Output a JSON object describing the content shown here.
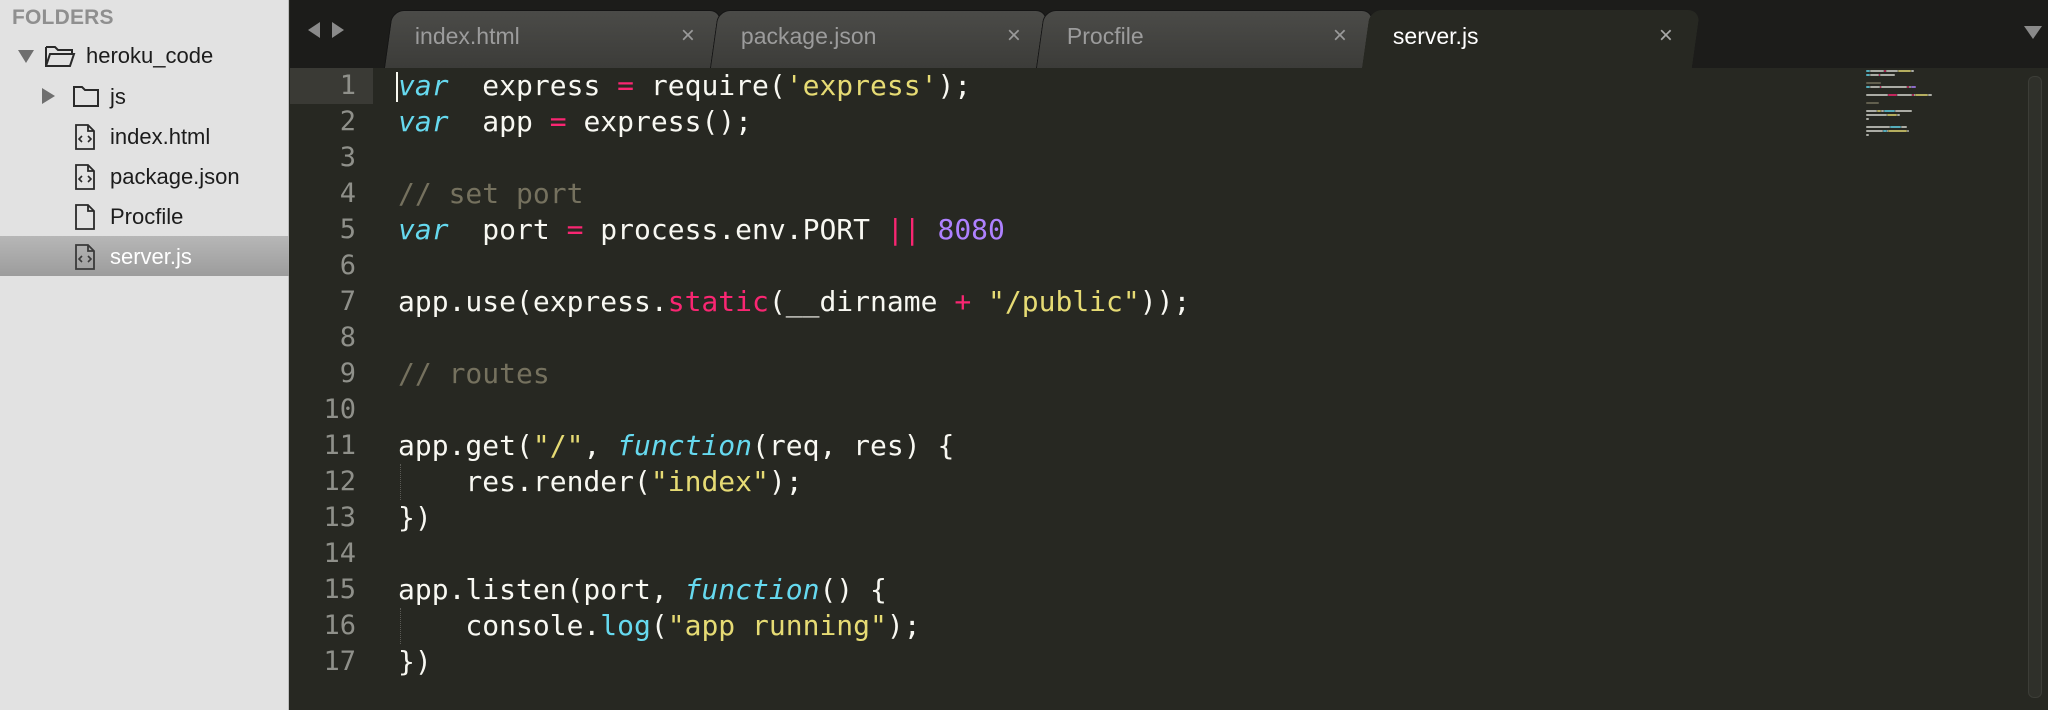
{
  "sidebar": {
    "header": "FOLDERS",
    "items": [
      {
        "label": "heroku_code",
        "icon": "folder-open-icon",
        "expanded": true
      },
      {
        "label": "js",
        "icon": "folder-icon",
        "expanded": false
      },
      {
        "label": "index.html",
        "icon": "code-file-icon"
      },
      {
        "label": "package.json",
        "icon": "code-file-icon"
      },
      {
        "label": "Procfile",
        "icon": "file-icon"
      },
      {
        "label": "server.js",
        "icon": "code-file-icon",
        "selected": true
      }
    ]
  },
  "tabs": [
    {
      "label": "index.html",
      "close": "×"
    },
    {
      "label": "package.json",
      "close": "×"
    },
    {
      "label": "Procfile",
      "close": "×"
    },
    {
      "label": "server.js",
      "close": "×",
      "active": true
    }
  ],
  "editor": {
    "current_line": 1,
    "lines": [
      {
        "n": "1",
        "tokens": [
          [
            "kw",
            "var"
          ],
          [
            "",
            "  express "
          ],
          [
            "op",
            "="
          ],
          [
            "",
            " require("
          ],
          [
            "str",
            "'express'"
          ],
          [
            "",
            ");"
          ]
        ]
      },
      {
        "n": "2",
        "tokens": [
          [
            "kw",
            "var"
          ],
          [
            "",
            "  app "
          ],
          [
            "op",
            "="
          ],
          [
            "",
            " express();"
          ]
        ]
      },
      {
        "n": "3",
        "tokens": []
      },
      {
        "n": "4",
        "tokens": [
          [
            "cm",
            "// set port"
          ]
        ]
      },
      {
        "n": "5",
        "tokens": [
          [
            "kw",
            "var"
          ],
          [
            "",
            "  port "
          ],
          [
            "op",
            "="
          ],
          [
            "",
            " process.env.PORT "
          ],
          [
            "op",
            "||"
          ],
          [
            "",
            " "
          ],
          [
            "num",
            "8080"
          ]
        ]
      },
      {
        "n": "6",
        "tokens": []
      },
      {
        "n": "7",
        "tokens": [
          [
            "",
            "app.use(express."
          ],
          [
            "sp",
            "static"
          ],
          [
            "",
            "(__dirname "
          ],
          [
            "op",
            "+"
          ],
          [
            "",
            " "
          ],
          [
            "str",
            "\"/public\""
          ],
          [
            "",
            "));"
          ]
        ]
      },
      {
        "n": "8",
        "tokens": []
      },
      {
        "n": "9",
        "tokens": [
          [
            "cm",
            "// routes"
          ]
        ]
      },
      {
        "n": "10",
        "tokens": []
      },
      {
        "n": "11",
        "tokens": [
          [
            "",
            "app.get("
          ],
          [
            "str",
            "\"/\""
          ],
          [
            "",
            ", "
          ],
          [
            "fn",
            "function"
          ],
          [
            "",
            "(req, res) {"
          ]
        ]
      },
      {
        "n": "12",
        "tokens": [
          [
            "",
            "    res.render("
          ],
          [
            "str",
            "\"index\""
          ],
          [
            "",
            ");"
          ]
        ]
      },
      {
        "n": "13",
        "tokens": [
          [
            "",
            "})"
          ]
        ]
      },
      {
        "n": "14",
        "tokens": []
      },
      {
        "n": "15",
        "tokens": [
          [
            "",
            "app.listen(port, "
          ],
          [
            "fn",
            "function"
          ],
          [
            "",
            "() {"
          ]
        ]
      },
      {
        "n": "16",
        "tokens": [
          [
            "",
            "    console."
          ],
          [
            "log",
            "log"
          ],
          [
            "",
            "("
          ],
          [
            "str",
            "\"app running\""
          ],
          [
            "",
            ");"
          ]
        ]
      },
      {
        "n": "17",
        "tokens": [
          [
            "",
            "})"
          ]
        ]
      }
    ]
  },
  "colors": {
    "background": "#272822",
    "keyword": "#66d9ef",
    "operator": "#f92672",
    "string": "#e6db74",
    "number": "#ae81ff",
    "comment": "#75715e"
  }
}
